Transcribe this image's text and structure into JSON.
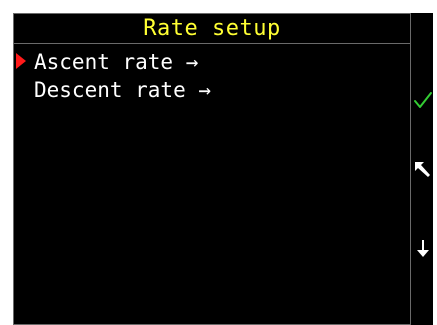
{
  "screen": {
    "title": "Rate setup"
  },
  "menu": {
    "items": [
      {
        "label": "Ascent rate →",
        "selected": true
      },
      {
        "label": "Descent rate →",
        "selected": false
      }
    ]
  },
  "softkeys": {
    "confirm_icon": "check-icon",
    "back_icon": "arrow-up-left-icon",
    "next_icon": "arrow-down-icon"
  },
  "colors": {
    "background": "#000000",
    "title": "#ffff33",
    "text": "#ffffff",
    "cursor": "#ff1a1a",
    "check": "#33cc33",
    "border": "#6a6a6a"
  }
}
